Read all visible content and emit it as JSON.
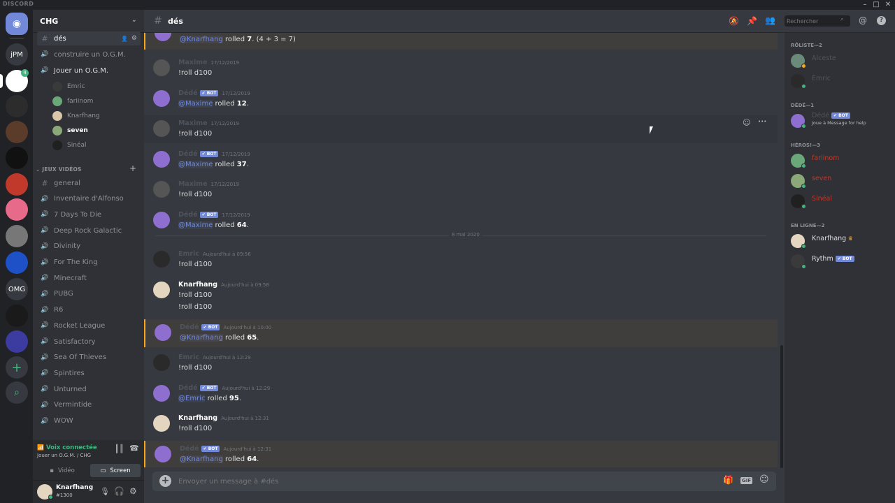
{
  "app": {
    "title": "DISCORD",
    "window_controls": [
      "–",
      "□",
      "✕"
    ]
  },
  "servers": [
    {
      "name": "home",
      "label": "",
      "color": "#7289da"
    },
    {
      "name": "jpm",
      "label": "jPM",
      "color": "#36393f"
    },
    {
      "name": "chg",
      "label": "",
      "color": "#ffffff",
      "badge": "4"
    },
    {
      "name": "server-3",
      "label": "",
      "color": "#2c2c2c"
    },
    {
      "name": "server-4",
      "label": "",
      "color": "#5b3b2a"
    },
    {
      "name": "server-5",
      "label": "",
      "color": "#111111"
    },
    {
      "name": "server-6",
      "label": "",
      "color": "#c0392b"
    },
    {
      "name": "server-7",
      "label": "",
      "color": "#e86a8a"
    },
    {
      "name": "server-8",
      "label": "",
      "color": "#777777"
    },
    {
      "name": "server-9",
      "label": "",
      "color": "#1e50c8"
    },
    {
      "name": "omg",
      "label": "OMG",
      "color": "#36393f"
    },
    {
      "name": "server-11",
      "label": "",
      "color": "#1a1a1a"
    },
    {
      "name": "server-12",
      "label": "",
      "color": "#3c3ca0"
    }
  ],
  "sidebar": {
    "guild_name": "CHG",
    "channels_top": [
      {
        "label": "dés",
        "type": "text",
        "state": "active"
      },
      {
        "label": "construire un O.G.M.",
        "type": "voice",
        "state": "normal"
      },
      {
        "label": "Jouer un O.G.M.",
        "type": "voice",
        "state": "bold"
      }
    ],
    "voice_users": [
      {
        "name": "Emric",
        "color": "#3a3a3a",
        "bold": false
      },
      {
        "name": "fariinom",
        "color": "#6aa87a",
        "bold": false
      },
      {
        "name": "Knarfhang",
        "color": "#d8c7a8",
        "bold": false
      },
      {
        "name": "seven",
        "color": "#8aa878",
        "bold": true
      },
      {
        "name": "Sinéal",
        "color": "#202020",
        "bold": false
      }
    ],
    "category": "JEUX VIDÉOS",
    "game_channels": [
      {
        "label": "general",
        "type": "text"
      },
      {
        "label": "Inventaire d'Alfonso",
        "type": "voice"
      },
      {
        "label": "7 Days To Die",
        "type": "voice"
      },
      {
        "label": "Deep Rock Galactic",
        "type": "voice"
      },
      {
        "label": "Divinity",
        "type": "voice"
      },
      {
        "label": "For The King",
        "type": "voice"
      },
      {
        "label": "Minecraft",
        "type": "voice"
      },
      {
        "label": "PUBG",
        "type": "voice"
      },
      {
        "label": "R6",
        "type": "voice"
      },
      {
        "label": "Rocket League",
        "type": "voice"
      },
      {
        "label": "Satisfactory",
        "type": "voice"
      },
      {
        "label": "Sea Of Thieves",
        "type": "voice"
      },
      {
        "label": "Spintires",
        "type": "voice"
      },
      {
        "label": "Unturned",
        "type": "voice"
      },
      {
        "label": "Vermintide",
        "type": "voice"
      },
      {
        "label": "WOW",
        "type": "voice"
      }
    ],
    "voice_status": "Voix connectée",
    "voice_location": "Jouer un O.G.M. / CHG",
    "video_label": "Vidéo",
    "screen_label": "Screen",
    "user": {
      "name": "Knarfhang",
      "tag": "#1300"
    }
  },
  "chat": {
    "channel": "dés",
    "search_placeholder": "Rechercher",
    "composer_placeholder": "Envoyer un message à #dés",
    "divider": "8 mai 2020",
    "messages": [
      {
        "author": "",
        "bot": false,
        "time": "",
        "color": "#7289da",
        "av": "#8e6fd0",
        "lines": [
          {
            "mention": "@Knarfhang",
            "text": " rolled ",
            "bold": "7",
            "suffix": ". (4 + 3 = 7)"
          }
        ],
        "highlight": true,
        "partial": true
      },
      {
        "author": "Maxime",
        "bot": false,
        "time": "17/12/2019",
        "color": "#4f545c",
        "av": "#555",
        "lines": [
          {
            "text": "!roll d100"
          }
        ]
      },
      {
        "author": "Dédé",
        "bot": true,
        "time": "17/12/2019",
        "color": "#4f545c",
        "av": "#8e6fd0",
        "lines": [
          {
            "mention": "@Maxime",
            "text": " rolled ",
            "bold": "12",
            "suffix": "."
          }
        ]
      },
      {
        "author": "Maxime",
        "bot": false,
        "time": "17/12/2019",
        "color": "#4f545c",
        "av": "#555",
        "lines": [
          {
            "text": "!roll d100"
          }
        ],
        "hover": true
      },
      {
        "author": "Dédé",
        "bot": true,
        "time": "17/12/2019",
        "color": "#4f545c",
        "av": "#8e6fd0",
        "lines": [
          {
            "mention": "@Maxime",
            "text": " rolled ",
            "bold": "37",
            "suffix": "."
          }
        ]
      },
      {
        "author": "Maxime",
        "bot": false,
        "time": "17/12/2019",
        "color": "#4f545c",
        "av": "#555",
        "lines": [
          {
            "text": "!roll d100"
          }
        ]
      },
      {
        "author": "Dédé",
        "bot": true,
        "time": "17/12/2019",
        "color": "#4f545c",
        "av": "#8e6fd0",
        "lines": [
          {
            "mention": "@Maxime",
            "text": " rolled ",
            "bold": "64",
            "suffix": "."
          }
        ]
      },
      {
        "author": "Emric",
        "bot": false,
        "time": "Aujourd'hui à 09:56",
        "color": "#4f545c",
        "av": "#2a2a2a",
        "lines": [
          {
            "text": "!roll d100"
          }
        ]
      },
      {
        "author": "Knarfhang",
        "bot": false,
        "time": "Aujourd'hui à 09:58",
        "color": "#ffffff",
        "av": "#e3d5c0",
        "lines": [
          {
            "text": "!roll d100"
          },
          {
            "text": "!roll d100"
          }
        ]
      },
      {
        "author": "Dédé",
        "bot": true,
        "time": "Aujourd'hui à 10:00",
        "color": "#4f545c",
        "av": "#8e6fd0",
        "lines": [
          {
            "mention": "@Knarfhang",
            "text": " rolled ",
            "bold": "65",
            "suffix": "."
          }
        ],
        "highlight": true
      },
      {
        "author": "Emric",
        "bot": false,
        "time": "Aujourd'hui à 12:29",
        "color": "#4f545c",
        "av": "#2a2a2a",
        "lines": [
          {
            "text": "!roll d100"
          }
        ]
      },
      {
        "author": "Dédé",
        "bot": true,
        "time": "Aujourd'hui à 12:29",
        "color": "#4f545c",
        "av": "#8e6fd0",
        "lines": [
          {
            "mention": "@Emric",
            "text": " rolled ",
            "bold": "95",
            "suffix": "."
          }
        ]
      },
      {
        "author": "Knarfhang",
        "bot": false,
        "time": "Aujourd'hui à 12:31",
        "color": "#ffffff",
        "av": "#e3d5c0",
        "lines": [
          {
            "text": "!roll d100"
          }
        ]
      },
      {
        "author": "Dédé",
        "bot": true,
        "time": "Aujourd'hui à 12:31",
        "color": "#4f545c",
        "av": "#8e6fd0",
        "lines": [
          {
            "mention": "@Knarfhang",
            "text": " rolled ",
            "bold": "64",
            "suffix": "."
          }
        ],
        "highlight": true
      }
    ]
  },
  "members": {
    "groups": [
      {
        "title": "RÔLISTE—2",
        "items": [
          {
            "name": "Alceste",
            "color": "#4f545c",
            "av": "#6a8a7a",
            "status": "#faa61a"
          },
          {
            "name": "Emric",
            "color": "#4f545c",
            "av": "#2a2a2a",
            "status": "#43b581"
          }
        ]
      },
      {
        "title": "DÉDÉ—1",
        "items": [
          {
            "name": "Dédé",
            "color": "#4f545c",
            "av": "#8e6fd0",
            "status": "#43b581",
            "bot": true,
            "sub": "Joue à Message for help"
          }
        ]
      },
      {
        "title": "HÉROS!—3",
        "items": [
          {
            "name": "fariinom",
            "color": "#c0392b",
            "av": "#6aa87a",
            "status": "#43b581"
          },
          {
            "name": "seven",
            "color": "#c0392b",
            "av": "#8aa878",
            "status": "#43b581"
          },
          {
            "name": "Sinéal",
            "color": "#c0392b",
            "av": "#202020",
            "status": "#43b581"
          }
        ]
      },
      {
        "title": "EN LIGNE—2",
        "items": [
          {
            "name": "Knarfhang",
            "color": "#dcddde",
            "av": "#e3d5c0",
            "status": "#43b581",
            "crown": true
          },
          {
            "name": "Rythm",
            "color": "#dcddde",
            "av": "#3a3a3a",
            "status": "#43b581",
            "bot": true
          }
        ]
      }
    ]
  },
  "bot_label": "✔ BOT"
}
